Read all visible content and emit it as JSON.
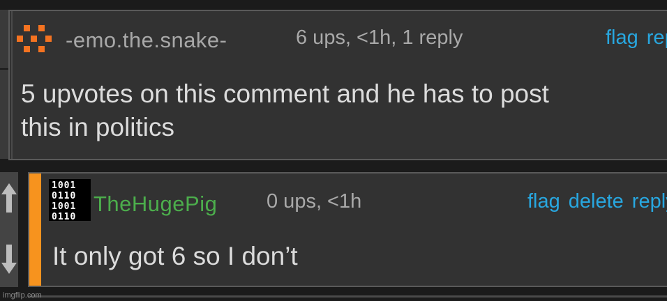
{
  "comments": [
    {
      "username": "-emo.the.snake-",
      "meta": "6 ups, <1h, 1 reply",
      "actions": [
        "flag",
        "reply"
      ],
      "text_lines": [
        "5 upvotes on this comment and he has to post",
        "this in politics"
      ],
      "username_color": "#a8a8a8",
      "avatar_icon": "pixel-pattern-icon"
    },
    {
      "username": "TheHugePig",
      "meta": "0 ups, <1h",
      "actions": [
        "flag",
        "delete",
        "reply"
      ],
      "text_lines": [
        "It only got 6 so I don’t"
      ],
      "username_color": "#4cae4c",
      "avatar_icon": "binary-code-icon",
      "avatar_rows": [
        "1001",
        "0110",
        "1001",
        "0110"
      ]
    }
  ],
  "vote": {
    "up_icon": "upvote-arrow-icon",
    "down_icon": "downvote-arrow-icon"
  },
  "colors": {
    "accent": "#f7931e",
    "link": "#28a7e0",
    "background": "#323232"
  },
  "watermark": "imgflip.com"
}
